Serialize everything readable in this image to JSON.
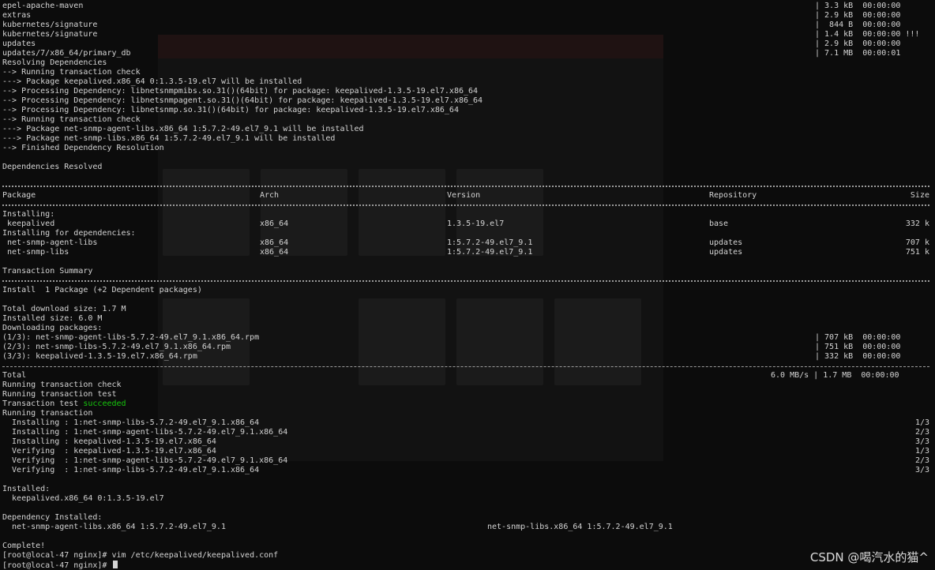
{
  "window": {
    "prompt_1": "[root@local-47 nginx]# vim /etc/keepalived/keepalived.conf",
    "prompt_2": "[root@local-47 nginx]# "
  },
  "repo_status": [
    {
      "name": "epel-apache-maven",
      "stat": "| 3.3 kB  00:00:00"
    },
    {
      "name": "extras",
      "stat": "| 2.9 kB  00:00:00"
    },
    {
      "name": "kubernetes/signature",
      "stat": "|  844 B  00:00:00"
    },
    {
      "name": "kubernetes/signature",
      "stat": "| 1.4 kB  00:00:00 !!!"
    },
    {
      "name": "updates",
      "stat": "| 2.9 kB  00:00:00"
    },
    {
      "name": "updates/7/x86_64/primary_db",
      "stat": "| 7.1 MB  00:00:01"
    }
  ],
  "resolve_lines": [
    "Resolving Dependencies",
    "--> Running transaction check",
    "---> Package keepalived.x86_64 0:1.3.5-19.el7 will be installed",
    "--> Processing Dependency: libnetsnmpmibs.so.31()(64bit) for package: keepalived-1.3.5-19.el7.x86_64",
    "--> Processing Dependency: libnetsnmpagent.so.31()(64bit) for package: keepalived-1.3.5-19.el7.x86_64",
    "--> Processing Dependency: libnetsnmp.so.31()(64bit) for package: keepalived-1.3.5-19.el7.x86_64",
    "--> Running transaction check",
    "---> Package net-snmp-agent-libs.x86_64 1:5.7.2-49.el7_9.1 will be installed",
    "---> Package net-snmp-libs.x86_64 1:5.7.2-49.el7_9.1 will be installed",
    "--> Finished Dependency Resolution"
  ],
  "deps_resolved": "Dependencies Resolved",
  "table": {
    "headers": {
      "package": "Package",
      "arch": "Arch",
      "version": "Version",
      "repository": "Repository",
      "size": "Size"
    },
    "installing_label": "Installing:",
    "installing": [
      {
        "package": " keepalived",
        "arch": "x86_64",
        "version": "1.3.5-19.el7",
        "repository": "base",
        "size": "332 k"
      }
    ],
    "deps_label": "Installing for dependencies:",
    "deps": [
      {
        "package": " net-snmp-agent-libs",
        "arch": "x86_64",
        "version": "1:5.7.2-49.el7_9.1",
        "repository": "updates",
        "size": "707 k"
      },
      {
        "package": " net-snmp-libs",
        "arch": "x86_64",
        "version": "1:5.7.2-49.el7_9.1",
        "repository": "updates",
        "size": "751 k"
      }
    ]
  },
  "summary": {
    "title": "Transaction Summary",
    "install_line": "Install  1 Package (+2 Dependent packages)",
    "download_size": "Total download size: 1.7 M",
    "installed_size": "Installed size: 6.0 M",
    "downloading": "Downloading packages:"
  },
  "downloads": [
    {
      "name": "(1/3): net-snmp-agent-libs-5.7.2-49.el7_9.1.x86_64.rpm",
      "stat": "| 707 kB  00:00:00"
    },
    {
      "name": "(2/3): net-snmp-libs-5.7.2-49.el7_9.1.x86_64.rpm",
      "stat": "| 751 kB  00:00:00"
    },
    {
      "name": "(3/3): keepalived-1.3.5-19.el7.x86_64.rpm",
      "stat": "| 332 kB  00:00:00"
    }
  ],
  "total": {
    "label": "Total",
    "stat": "6.0 MB/s | 1.7 MB  00:00:00"
  },
  "run_lines": {
    "check": "Running transaction check",
    "test": "Running transaction test",
    "test_result_prefix": "Transaction test ",
    "test_result_word": "succeeded",
    "running": "Running transaction"
  },
  "steps": [
    {
      "text": "  Installing : 1:net-snmp-libs-5.7.2-49.el7_9.1.x86_64",
      "count": "1/3"
    },
    {
      "text": "  Installing : 1:net-snmp-agent-libs-5.7.2-49.el7_9.1.x86_64",
      "count": "2/3"
    },
    {
      "text": "  Installing : keepalived-1.3.5-19.el7.x86_64",
      "count": "3/3"
    },
    {
      "text": "  Verifying  : keepalived-1.3.5-19.el7.x86_64",
      "count": "1/3"
    },
    {
      "text": "  Verifying  : 1:net-snmp-agent-libs-5.7.2-49.el7_9.1.x86_64",
      "count": "2/3"
    },
    {
      "text": "  Verifying  : 1:net-snmp-libs-5.7.2-49.el7_9.1.x86_64",
      "count": "3/3"
    }
  ],
  "installed": {
    "label": "Installed:",
    "value": "  keepalived.x86_64 0:1.3.5-19.el7"
  },
  "dep_installed": {
    "label": "Dependency Installed:",
    "left": "  net-snmp-agent-libs.x86_64 1:5.7.2-49.el7_9.1",
    "right": "net-snmp-libs.x86_64 1:5.7.2-49.el7_9.1"
  },
  "complete": "Complete!",
  "watermark": "CSDN @喝汽水的猫^"
}
